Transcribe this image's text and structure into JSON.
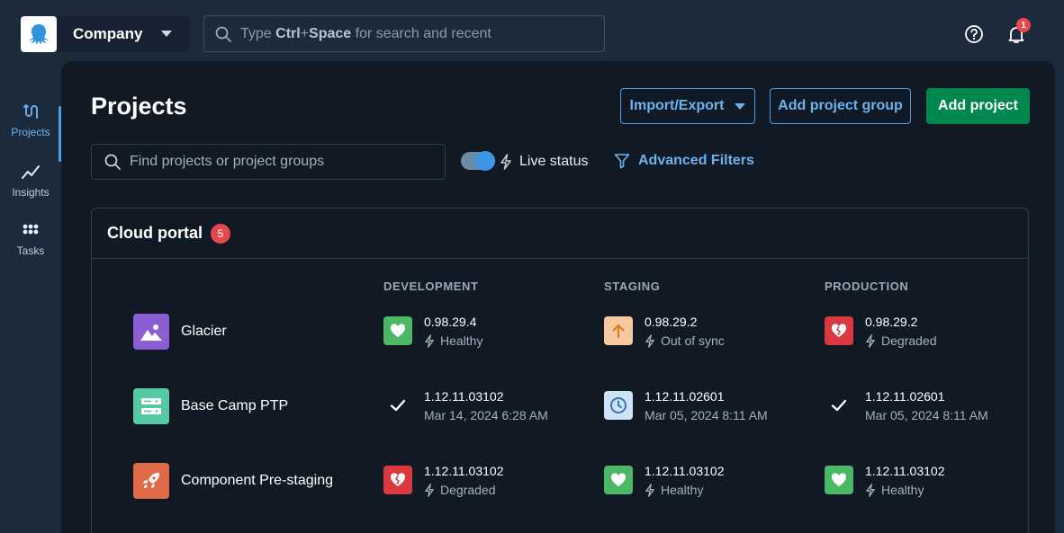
{
  "topbar": {
    "space_name": "Company",
    "search": {
      "prefix": "Type ",
      "shortcut_ctrl": "Ctrl",
      "shortcut_plus": "+",
      "shortcut_space": "Space",
      "suffix": " for search and recent"
    },
    "notification_count": "1"
  },
  "nav": {
    "items": [
      {
        "label": "Projects",
        "icon": "projects-icon",
        "active": true
      },
      {
        "label": "Insights",
        "icon": "chart-line-icon",
        "active": false
      },
      {
        "label": "Tasks",
        "icon": "grid-dots-icon",
        "active": false
      }
    ]
  },
  "page": {
    "title": "Projects",
    "import_export_label": "Import/Export",
    "add_group_label": "Add project group",
    "add_project_label": "Add project",
    "search_placeholder": "Find projects or project groups",
    "live_status_label": "Live status",
    "advanced_filters_label": "Advanced Filters"
  },
  "group": {
    "name": "Cloud portal",
    "count": "5",
    "columns": [
      "DEVELOPMENT",
      "STAGING",
      "PRODUCTION"
    ],
    "projects": [
      {
        "name": "Glacier",
        "logo": "mountain-image-icon",
        "logo_color": "#8b5ed6",
        "envs": [
          {
            "version": "0.98.29.4",
            "status": "Healthy",
            "kind": "healthy"
          },
          {
            "version": "0.98.29.2",
            "status": "Out of sync",
            "kind": "outofsync"
          },
          {
            "version": "0.98.29.2",
            "status": "Degraded",
            "kind": "degraded"
          }
        ]
      },
      {
        "name": "Base Camp PTP",
        "logo": "server-icon",
        "logo_color": "#55c9a3",
        "envs": [
          {
            "version": "1.12.11.03102",
            "status": "Mar 14, 2024 6:28 AM",
            "kind": "success"
          },
          {
            "version": "1.12.11.02601",
            "status": "Mar 05, 2024 8:11 AM",
            "kind": "queued"
          },
          {
            "version": "1.12.11.02601",
            "status": "Mar 05, 2024 8:11 AM",
            "kind": "success"
          }
        ]
      },
      {
        "name": "Component Pre-staging",
        "logo": "rocket-icon",
        "logo_color": "#e06a47",
        "envs": [
          {
            "version": "1.12.11.03102",
            "status": "Degraded",
            "kind": "degraded"
          },
          {
            "version": "1.12.11.03102",
            "status": "Healthy",
            "kind": "healthy"
          },
          {
            "version": "1.12.11.03102",
            "status": "Healthy",
            "kind": "healthy"
          }
        ]
      }
    ]
  },
  "colors": {
    "healthy": "#4cb866",
    "degraded": "#d9393f",
    "outofsync": "#f7c9a0",
    "queued": "#cfe3f7",
    "primary": "#00874d",
    "link": "#6cb3ee"
  }
}
